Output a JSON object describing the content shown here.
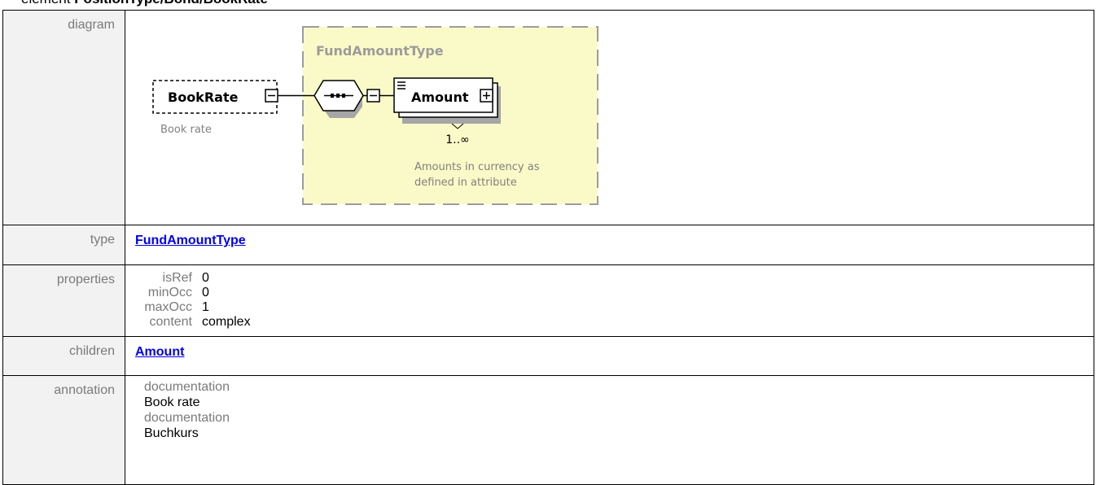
{
  "title": {
    "prefix": "element",
    "path": "PositionType/Bond/BookRate"
  },
  "rows": {
    "diagram": {
      "label": "diagram"
    },
    "type": {
      "label": "type",
      "value": "FundAmountType"
    },
    "properties": {
      "label": "properties",
      "items": [
        {
          "key": "isRef",
          "value": "0"
        },
        {
          "key": "minOcc",
          "value": "0"
        },
        {
          "key": "maxOcc",
          "value": "1"
        },
        {
          "key": "content",
          "value": "complex"
        }
      ]
    },
    "children": {
      "label": "children",
      "value": "Amount"
    },
    "annotation": {
      "label": "annotation",
      "entries": [
        {
          "key": "documentation",
          "value": "Book rate"
        },
        {
          "key": "documentation",
          "value": "Buchkurs"
        }
      ]
    }
  },
  "diagram": {
    "group_title": "FundAmountType",
    "element_name": "BookRate",
    "element_doc": "Book rate",
    "child_name": "Amount",
    "child_cardinality": "1..∞",
    "child_doc_line1": "Amounts in currency as",
    "child_doc_line2": "defined in attribute",
    "colors": {
      "group_fill": "#fafac8",
      "group_border": "#9c9c9c",
      "shadow": "#a6a6a6",
      "doc_text": "#808080"
    }
  }
}
